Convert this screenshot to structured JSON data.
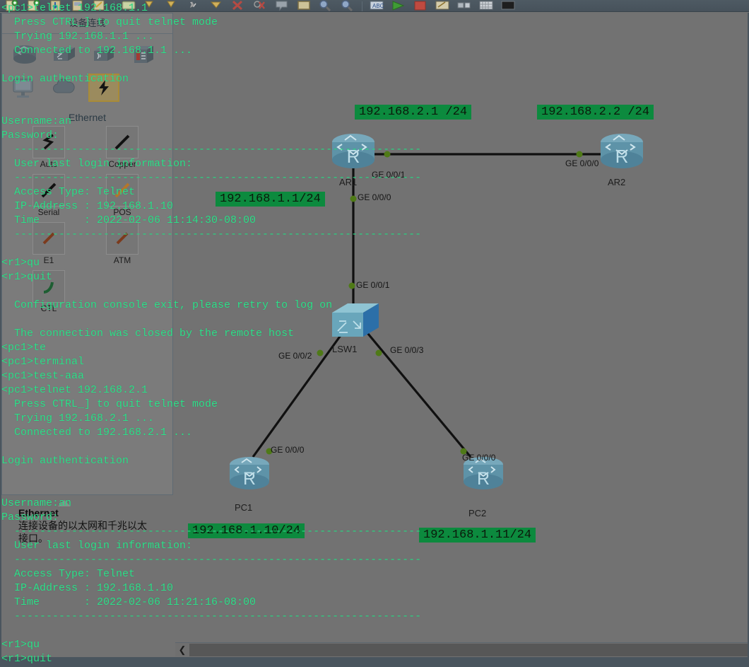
{
  "toolbar": {
    "buttons": [
      {
        "name": "new-topology-icon",
        "glyph": "new"
      },
      {
        "name": "open-topology-icon",
        "glyph": "open"
      },
      {
        "name": "save-icon",
        "glyph": "save"
      },
      {
        "name": "save-as-icon",
        "glyph": "saveas"
      },
      {
        "name": "print-icon",
        "glyph": "print"
      },
      {
        "name": "undo-icon",
        "glyph": "undo"
      },
      {
        "name": "redo-icon",
        "glyph": "redo"
      },
      {
        "name": "select-cursor-icon",
        "glyph": "cursor"
      },
      {
        "name": "polygon-icon",
        "glyph": "polygon"
      },
      {
        "name": "delete-icon",
        "glyph": "delete"
      },
      {
        "name": "delete-link-icon",
        "glyph": "deletelink"
      },
      {
        "name": "note-icon",
        "glyph": "note"
      },
      {
        "name": "text-box-icon",
        "glyph": "textbox"
      },
      {
        "name": "zoom-in-icon",
        "glyph": "zoomin"
      },
      {
        "name": "zoom-out-icon",
        "glyph": "zoomout"
      },
      {
        "name": "capture-icon",
        "glyph": "capture"
      },
      {
        "name": "start-all-icon",
        "glyph": "start"
      },
      {
        "name": "stop-all-icon",
        "glyph": "stop"
      },
      {
        "name": "cli-icon",
        "glyph": "cli"
      },
      {
        "name": "device-migrate-icon",
        "glyph": "migrate"
      },
      {
        "name": "grid-icon",
        "glyph": "grid"
      },
      {
        "name": "fullscreen-icon",
        "glyph": "fullscreen"
      },
      {
        "name": "restore-icon",
        "glyph": "restore"
      },
      {
        "name": "close-icon",
        "glyph": "close"
      }
    ]
  },
  "device_panel": {
    "title": "设备连线",
    "devices": [
      {
        "name": "router-category-icon",
        "label": "router"
      },
      {
        "name": "switch-category-icon",
        "label": "switch"
      },
      {
        "name": "wlan-category-icon",
        "label": "wlan"
      },
      {
        "name": "firewall-category-icon",
        "label": "firewall"
      },
      {
        "name": "terminal-category-icon",
        "label": "terminal"
      },
      {
        "name": "cloud-category-icon",
        "label": "cloud"
      },
      {
        "name": "connections-category-icon",
        "label": "connections"
      }
    ],
    "cable_group_title": "Ethernet",
    "cables": [
      {
        "label": "Auto",
        "icon": "auto-cable-icon",
        "selected": false
      },
      {
        "label": "Copper",
        "icon": "copper-cable-icon",
        "selected": false
      },
      {
        "label": "Serial",
        "icon": "serial-cable-icon",
        "selected": false
      },
      {
        "label": "POS",
        "icon": "pos-cable-icon",
        "selected": false
      },
      {
        "label": "E1",
        "icon": "e1-cable-icon",
        "selected": false
      },
      {
        "label": "ATM",
        "icon": "atm-cable-icon",
        "selected": false
      },
      {
        "label": "CTL",
        "icon": "ctl-cable-icon",
        "selected": false
      }
    ]
  },
  "tooltip": {
    "title": "Ethernet",
    "body": "连接设备的以太网和千兆以太接口。"
  },
  "topology": {
    "nodes": [
      {
        "id": "AR1",
        "label": "AR1",
        "type": "router"
      },
      {
        "id": "AR2",
        "label": "AR2",
        "type": "router"
      },
      {
        "id": "LSW1",
        "label": "LSW1",
        "type": "switch"
      },
      {
        "id": "PC1",
        "label": "PC1",
        "type": "router"
      },
      {
        "id": "PC2",
        "label": "PC2",
        "type": "router"
      }
    ],
    "interfaces": [
      {
        "id": "ar1-ge001",
        "text": "GE 0/0/1"
      },
      {
        "id": "ar1-ge000",
        "text": "GE 0/0/0"
      },
      {
        "id": "ar2-ge000",
        "text": "GE 0/0/0"
      },
      {
        "id": "lsw1-ge001",
        "text": "GE 0/0/1"
      },
      {
        "id": "lsw1-ge002",
        "text": "GE 0/0/2"
      },
      {
        "id": "lsw1-ge003",
        "text": "GE 0/0/3"
      },
      {
        "id": "pc1-ge000",
        "text": "GE 0/0/0"
      },
      {
        "id": "pc2-ge000",
        "text": "GE 0/0/0"
      }
    ],
    "ip_labels": [
      {
        "id": "ip-ar1-ge001",
        "text": "192.168.2.1 /24"
      },
      {
        "id": "ip-ar2-ge000",
        "text": "192.168.2.2 /24"
      },
      {
        "id": "ip-ar1-ge000",
        "text": "192.168.1.1/24"
      },
      {
        "id": "ip-pc1",
        "text": "192.168.1.10/24"
      },
      {
        "id": "ip-pc2",
        "text": "192.168.1.11/24"
      }
    ],
    "colors": {
      "ip_badge_bg": "#0c8a3e",
      "link": "#101010",
      "port_dot": "#4f7a17"
    }
  },
  "scrollbar": {
    "left_arrow": "❮"
  },
  "terminal": {
    "lines": [
      "<pc1>telnet 192.168.1.1",
      "  Press CTRL_] to quit telnet mode",
      "  Trying 192.168.1.1 ...",
      "  Connected to 192.168.1.1 ...",
      "",
      "Login authentication",
      "",
      "",
      "Username:an",
      "Password:",
      "  ----------------------------------------------------------------",
      "  User last login information:",
      "  ----------------------------------------------------------------",
      "  Access Type: Telnet",
      "  IP-Address : 192.168.1.10",
      "  Time       : 2022-02-06 11:14:30-08:00",
      "  ----------------------------------------------------------------",
      "",
      "<r1>qu",
      "<r1>quit",
      "",
      "  Configuration console exit, please retry to log on",
      "",
      "  The connection was closed by the remote host",
      "<pc1>te",
      "<pc1>terminal",
      "<pc1>test-aaa",
      "<pc1>telnet 192.168.2.1",
      "  Press CTRL_] to quit telnet mode",
      "  Trying 192.168.2.1 ...",
      "  Connected to 192.168.2.1 ...",
      "",
      "Login authentication",
      "",
      "",
      "Username:an",
      "Password:",
      "  ----------------------------------------------------------------",
      "  User last login information:",
      "  ----------------------------------------------------------------",
      "  Access Type: Telnet",
      "  IP-Address : 192.168.1.10",
      "  Time       : 2022-02-06 11:21:16-08:00",
      "  ----------------------------------------------------------------",
      "",
      "<r1>qu",
      "<r1>quit"
    ],
    "text_color": "#2ee08a"
  }
}
